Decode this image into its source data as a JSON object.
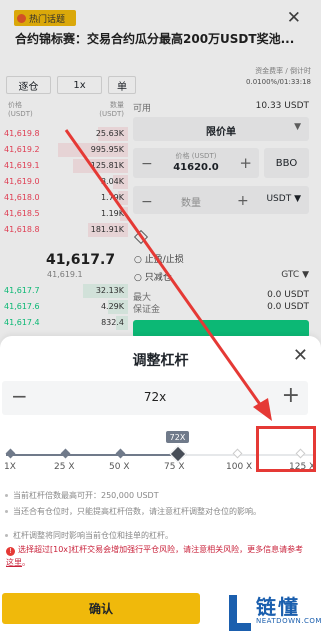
{
  "banner": {
    "tag": "热门话题",
    "text": "合约锦标赛：交易合约瓜分最高200万USDT奖池..."
  },
  "toolbar": {
    "margin_mode": "逐仓",
    "leverage": "1x",
    "mode": "单"
  },
  "fees": {
    "label": "资金费率 / 倒计时",
    "value": "0.0100%/01:33:18"
  },
  "orderbook": {
    "price_header": "价格",
    "price_unit": "(USDT)",
    "qty_header": "数量",
    "qty_unit": "(USDT)",
    "asks": [
      {
        "price": "41,619.8",
        "qty": "25.63K"
      },
      {
        "price": "41,619.2",
        "qty": "995.95K"
      },
      {
        "price": "41,619.1",
        "qty": "125.81K"
      },
      {
        "price": "41,619.0",
        "qty": "3.04K"
      },
      {
        "price": "41,618.0",
        "qty": "1.79K"
      },
      {
        "price": "41,618.5",
        "qty": "1.19K"
      },
      {
        "price": "41,618.8",
        "qty": "181.91K"
      }
    ],
    "last_price": "41,617.7",
    "last_sub": "41,619.1",
    "bids": [
      {
        "price": "41,617.7",
        "qty": "32.13K"
      },
      {
        "price": "41,617.6",
        "qty": "4.29K"
      },
      {
        "price": "41,617.4",
        "qty": "832.4"
      }
    ]
  },
  "order_panel": {
    "available_label": "可用",
    "available_value": "10.33 USDT",
    "order_type": "限价单",
    "price_label": "价格 (USDT)",
    "price_value": "41620.0",
    "bbo": "BBO",
    "qty_placeholder": "数量",
    "qty_unit": "USDT",
    "tpsl": "止盈/止损",
    "reduce_only": "只减仓",
    "tif": "GTC",
    "max_label": "最大",
    "max_value": "0.0 USDT",
    "margin_label": "保证金",
    "margin_value": "0.0 USDT"
  },
  "sheet": {
    "title": "调整杠杆",
    "value": "72x",
    "current_bubble": "72X",
    "ticks": [
      "1X",
      "25 X",
      "50 X",
      "75 X",
      "100 X",
      "125 X"
    ],
    "level_fraction": 0.575,
    "notes": [
      "当前杠杆倍数最高可开：250,000 USDT",
      "当还合有仓位时，只能提高杠杆倍数，请注意杠杆调整对仓位的影响。",
      "杠杆调整将同时影响当前仓位和挂单的杠杆。"
    ],
    "warning": "选择超过[10x]杠杆交易会增加强行平仓风险，请注意相关风险，更多信息请参考",
    "warning_link": "这里",
    "confirm": "确认"
  },
  "watermark": {
    "cn": "链懂",
    "en": "NEATDOWN.COM"
  },
  "colors": {
    "accent": "#f0b90b",
    "sell": "#f6465d",
    "buy": "#0ecb81",
    "annotation": "#e53935"
  }
}
